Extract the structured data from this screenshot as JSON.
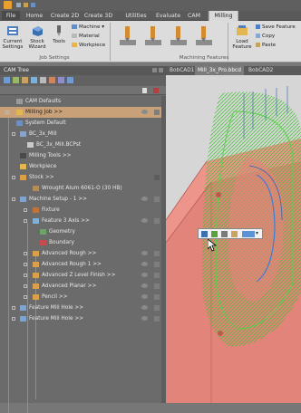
{
  "menu": {
    "tabs": [
      "File",
      "Home",
      "Create 2D",
      "Create 3D",
      "Utilities",
      "Evaluate",
      "CAM",
      "Milling"
    ],
    "active_tab": "Milling"
  },
  "ribbon": {
    "current_settings": [
      "Current",
      "Settings"
    ],
    "stock_wizard": [
      "Stock",
      "Wizard"
    ],
    "tools": "Tools",
    "machine": "Machine",
    "material": "Material",
    "workpiece": "Workpiece",
    "load_feature": [
      "Load",
      "Feature"
    ],
    "save_feature": "Save Feature",
    "copy": "Copy",
    "paste": "Paste",
    "group_job_settings": "Job Settings",
    "group_machining_features": "Machining Features"
  },
  "cam_tree": {
    "title": "CAM Tree",
    "items": [
      {
        "label": "CAM Defaults"
      },
      {
        "label": "Milling Job  >>"
      },
      {
        "label": "System Default"
      },
      {
        "label": "BC_3x_Mill"
      },
      {
        "label": "BC_3x_Mill.BCPst"
      },
      {
        "label": "Milling Tools  >>"
      },
      {
        "label": "Workpiece"
      },
      {
        "label": "Stock  >>"
      },
      {
        "label": "Wrought Alum 6061-O (30 HB)"
      },
      {
        "label": "Machine Setup - 1  >>"
      },
      {
        "label": "Fixture"
      },
      {
        "label": "Feature 3 Axis  >>"
      },
      {
        "label": "Geometry"
      },
      {
        "label": "Boundary"
      },
      {
        "label": "Advanced Rough  >>"
      },
      {
        "label": "Advanced Rough 1  >>"
      },
      {
        "label": "Advanced Z Level Finish  >>"
      },
      {
        "label": "Advanced Planar  >>"
      },
      {
        "label": "Pencil  >>"
      },
      {
        "label": "Feature Mill Hole  >>"
      },
      {
        "label": "Feature Mill Hole  >>"
      }
    ]
  },
  "viewport": {
    "tabs": [
      "BobCAD1",
      "Mill_3x_Pro.bbcd",
      "BobCAD2"
    ],
    "active_tab": "Mill_3x_Pro.bbcd"
  },
  "colors": {
    "selection": "#c8a178",
    "part": "#e07a70",
    "toolpath_green": "#44c838",
    "ribbon_bg": "#dcdcdc"
  }
}
